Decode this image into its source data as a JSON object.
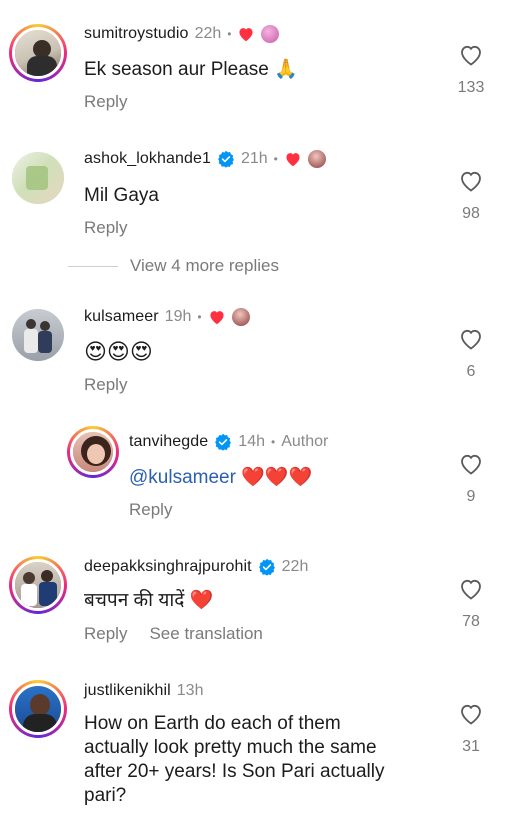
{
  "comments": [
    {
      "username": "sumitroystudio",
      "time": "22h",
      "text": "Ek season aur Please 🙏",
      "reply": "Reply",
      "likes": "133",
      "verified": false
    },
    {
      "username": "ashok_lokhande1",
      "time": "21h",
      "text": "Mil Gaya",
      "reply": "Reply",
      "likes": "98",
      "verified": true
    },
    {
      "username": "kulsameer",
      "time": "19h",
      "text": "😍😍😍",
      "reply": "Reply",
      "likes": "6",
      "verified": false
    },
    {
      "username": "tanvihegde",
      "time": "14h",
      "author_label": "Author",
      "mention": "@kulsameer",
      "text_after": " ❤️❤️❤️",
      "reply": "Reply",
      "likes": "9",
      "verified": true
    },
    {
      "username": "deepakksinghrajpurohit",
      "time": "22h",
      "text": "बचपन की यादें ❤️",
      "reply": "Reply",
      "see_translation": "See translation",
      "likes": "78",
      "verified": true
    },
    {
      "username": "justlikenikhil",
      "time": "13h",
      "text_lines": [
        "How on Earth do each of them",
        "actually look pretty much the same",
        "after 20+ years! Is Son Pari actually",
        "pari?"
      ],
      "likes": "31",
      "verified": false
    }
  ],
  "view_more": "View 4 more replies",
  "colors": {
    "heart_red": "#ff3040",
    "verified_blue": "#0095f6",
    "mention_blue": "#2a5fb4",
    "muted_gray": "#8a8a8a"
  }
}
